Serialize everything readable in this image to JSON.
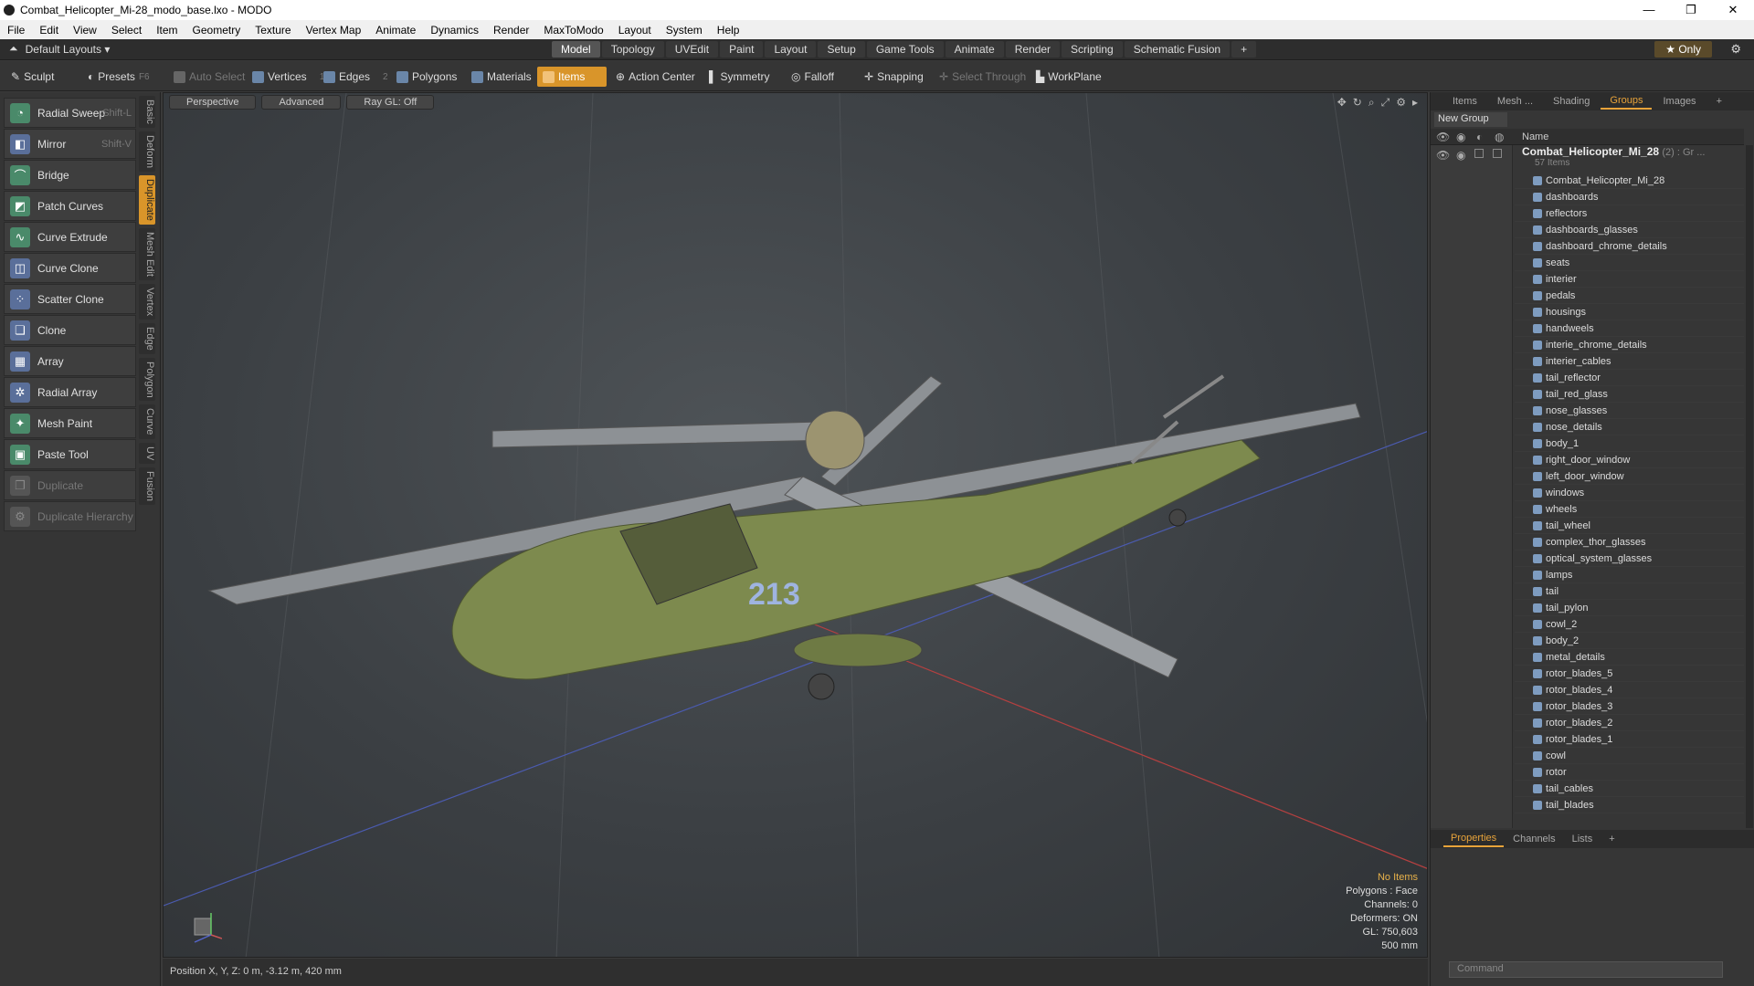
{
  "window": {
    "title": "Combat_Helicopter_Mi-28_modo_base.lxo - MODO",
    "controls": [
      "—",
      "❐",
      "✕"
    ]
  },
  "menu": [
    "File",
    "Edit",
    "View",
    "Select",
    "Item",
    "Geometry",
    "Texture",
    "Vertex Map",
    "Animate",
    "Dynamics",
    "Render",
    "MaxToModo",
    "Layout",
    "System",
    "Help"
  ],
  "layout_bar": {
    "layouts_label": "Default Layouts ▾",
    "tabs": [
      "Model",
      "Topology",
      "UVEdit",
      "Paint",
      "Layout",
      "Setup",
      "Game Tools",
      "Animate",
      "Render",
      "Scripting",
      "Schematic Fusion",
      "+"
    ],
    "active_tab": "Model",
    "only_label": "★ Only"
  },
  "toolbar": {
    "sculpt": "Sculpt",
    "presets": "Presets",
    "presets_key": "F6",
    "auto_select": "Auto Select",
    "vertices": "Vertices",
    "vertices_num": "1",
    "edges": "Edges",
    "edges_num": "2",
    "polygons": "Polygons",
    "materials": "Materials",
    "items": "Items",
    "action_center": "Action Center",
    "symmetry": "Symmetry",
    "falloff": "Falloff",
    "snapping": "Snapping",
    "select_through": "Select Through",
    "workplane": "WorkPlane"
  },
  "tools": [
    {
      "label": "Radial Sweep",
      "shortcut": "Shift-L",
      "icon": "radial-sweep-icon",
      "enabled": true
    },
    {
      "label": "Mirror",
      "shortcut": "Shift-V",
      "icon": "mirror-icon",
      "enabled": true
    },
    {
      "label": "Bridge",
      "shortcut": "",
      "icon": "bridge-icon",
      "enabled": true
    },
    {
      "label": "Patch Curves",
      "shortcut": "",
      "icon": "patch-curves-icon",
      "enabled": true
    },
    {
      "label": "Curve Extrude",
      "shortcut": "",
      "icon": "curve-extrude-icon",
      "enabled": true
    },
    {
      "label": "Curve Clone",
      "shortcut": "",
      "icon": "curve-clone-icon",
      "enabled": true
    },
    {
      "label": "Scatter Clone",
      "shortcut": "",
      "icon": "scatter-clone-icon",
      "enabled": true
    },
    {
      "label": "Clone",
      "shortcut": "",
      "icon": "clone-icon",
      "enabled": true
    },
    {
      "label": "Array",
      "shortcut": "",
      "icon": "array-icon",
      "enabled": true
    },
    {
      "label": "Radial Array",
      "shortcut": "",
      "icon": "radial-array-icon",
      "enabled": true
    },
    {
      "label": "Mesh Paint",
      "shortcut": "",
      "icon": "mesh-paint-icon",
      "enabled": true
    },
    {
      "label": "Paste Tool",
      "shortcut": "",
      "icon": "paste-tool-icon",
      "enabled": true
    },
    {
      "label": "Duplicate",
      "shortcut": "",
      "icon": "duplicate-icon",
      "enabled": false
    },
    {
      "label": "Duplicate Hierarchy",
      "shortcut": "",
      "icon": "duplicate-hierarchy-icon",
      "enabled": false
    }
  ],
  "vertical_tabs": [
    "Basic",
    "Deform",
    "Duplicate",
    "Mesh Edit",
    "Vertex",
    "Edge",
    "Polygon",
    "Curve",
    "UV",
    "Fusion"
  ],
  "active_vertical_tab": "Duplicate",
  "viewport": {
    "tabs": [
      "Perspective",
      "Advanced",
      "Ray GL: Off"
    ],
    "info": {
      "no_items": "No Items",
      "polygons": "Polygons : Face",
      "channels": "Channels: 0",
      "deformers": "Deformers: ON",
      "gl": "GL: 750,603",
      "scale": "500 mm"
    },
    "model_label": "213"
  },
  "status": "Position X, Y, Z:   0 m, -3.12 m, 420 mm",
  "right_panel": {
    "tabs": [
      "Items",
      "Mesh ...",
      "Shading",
      "Groups",
      "Images",
      "+"
    ],
    "active_tab": "Groups",
    "new_group": "New Group",
    "name_header": "Name",
    "root": {
      "name": "Combat_Helicopter_Mi_28",
      "count": "(2) : Gr ...",
      "sub": "57 Items"
    },
    "items": [
      "Combat_Helicopter_Mi_28",
      "dashboards",
      "reflectors",
      "dashboards_glasses",
      "dashboard_chrome_details",
      "seats",
      "interier",
      "pedals",
      "housings",
      "handweels",
      "interie_chrome_details",
      "interier_cables",
      "tail_reflector",
      "tail_red_glass",
      "nose_glasses",
      "nose_details",
      "body_1",
      "right_door_window",
      "left_door_window",
      "windows",
      "wheels",
      "tail_wheel",
      "complex_thor_glasses",
      "optical_system_glasses",
      "lamps",
      "tail",
      "tail_pylon",
      "cowl_2",
      "body_2",
      "metal_details",
      "rotor_blades_5",
      "rotor_blades_4",
      "rotor_blades_3",
      "rotor_blades_2",
      "rotor_blades_1",
      "cowl",
      "rotor",
      "tail_cables",
      "tail_blades"
    ],
    "prop_tabs": [
      "Properties",
      "Channels",
      "Lists",
      "+"
    ],
    "active_prop_tab": "Properties",
    "command_placeholder": "Command"
  },
  "colors": {
    "accent": "#e8a33a",
    "viewport_bg": "#3f4347",
    "panel_bg": "#363636"
  }
}
